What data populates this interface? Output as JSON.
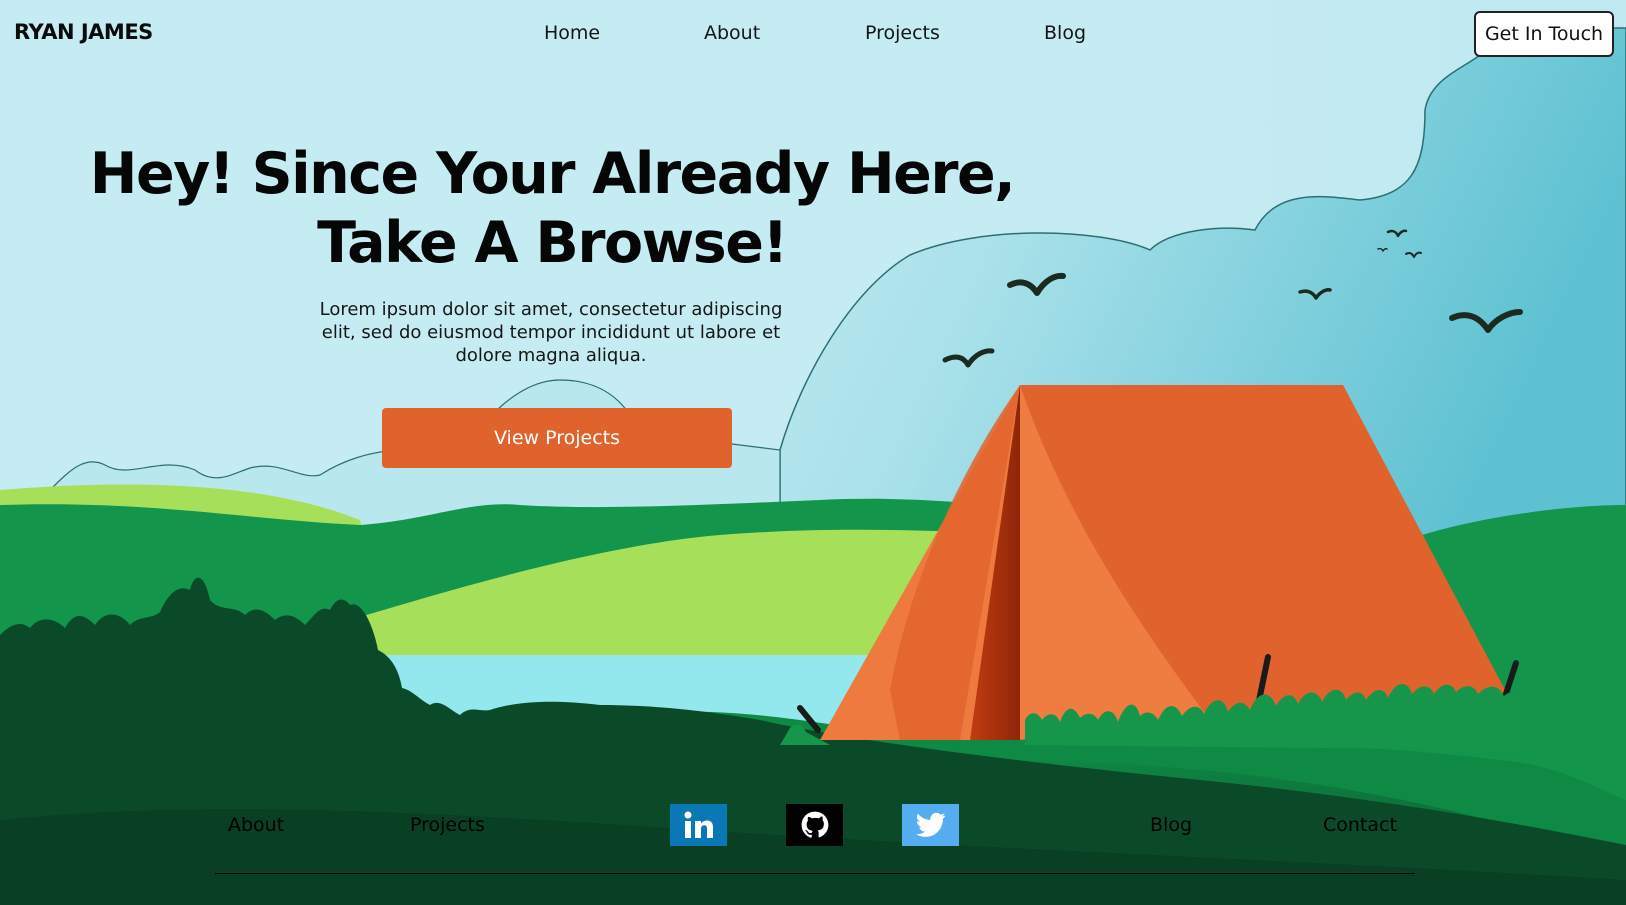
{
  "brand": {
    "name": "RYAN JAMES"
  },
  "nav": {
    "items": [
      {
        "label": "Home"
      },
      {
        "label": "About"
      },
      {
        "label": "Projects"
      },
      {
        "label": "Blog"
      }
    ],
    "cta_label": "Get In Touch"
  },
  "hero": {
    "title_line1": "Hey! Since Your Already Here,",
    "title_line2": "Take A Browse!",
    "subtitle": "Lorem ipsum dolor sit amet, consectetur adipiscing elit, sed do eiusmod tempor incididunt ut labore et dolore magna aliqua.",
    "button_label": "View Projects"
  },
  "footer": {
    "links": [
      {
        "label": "About"
      },
      {
        "label": "Projects"
      },
      {
        "label": "Blog"
      },
      {
        "label": "Contact"
      }
    ],
    "socials": [
      {
        "name": "linkedin-icon",
        "color": "#0a78b5"
      },
      {
        "name": "github-icon",
        "color": "#000000"
      },
      {
        "name": "twitter-icon",
        "color": "#55acee"
      }
    ]
  },
  "colors": {
    "sky": "#c6ecf3",
    "accent": "#e0622c",
    "tent_orange": "#e0622c",
    "dark_green": "#0c4a2a",
    "grass_green": "#13964c",
    "light_green": "#a6e05a",
    "lake": "#93e8ee"
  }
}
